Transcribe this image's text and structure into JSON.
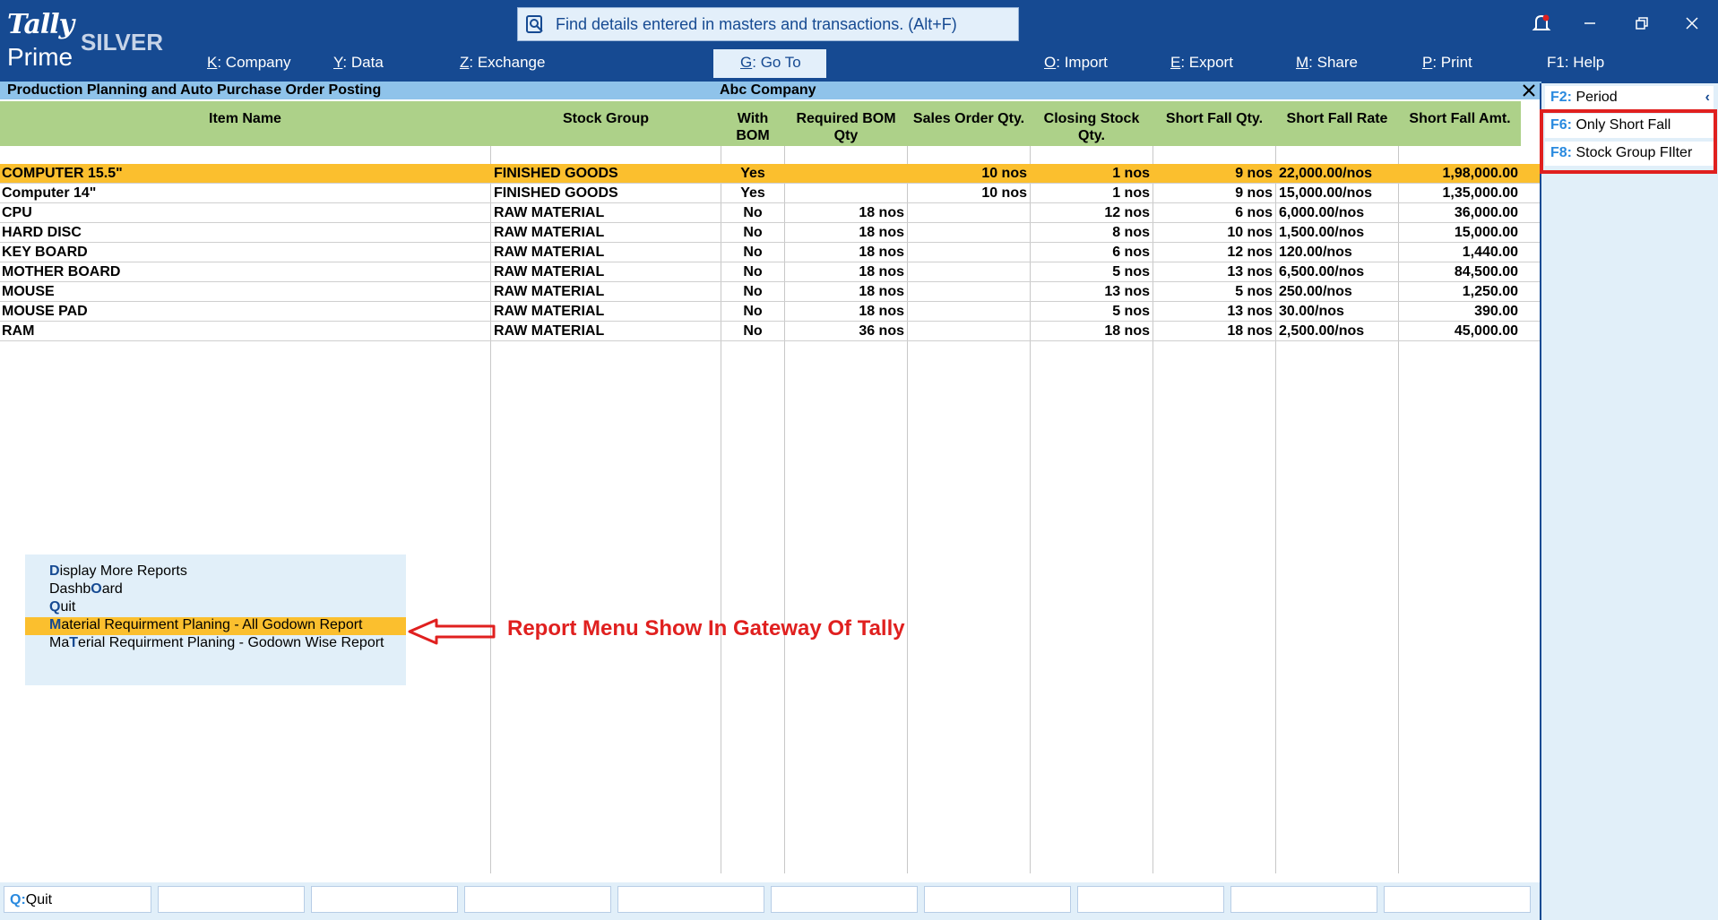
{
  "app": {
    "logo_top": "Tally",
    "logo_bottom": "Prime",
    "edition": "SILVER"
  },
  "search": {
    "text": "Find details entered in masters and transactions. (Alt+F)"
  },
  "menu": [
    {
      "key": "K",
      "label": "Company"
    },
    {
      "key": "Y",
      "label": "Data"
    },
    {
      "key": "Z",
      "label": "Exchange"
    },
    {
      "key": "G",
      "label": "Go To"
    },
    {
      "key": "O",
      "label": "Import"
    },
    {
      "key": "E",
      "label": "Export"
    },
    {
      "key": "M",
      "label": "Share"
    },
    {
      "key": "P",
      "label": "Print"
    },
    {
      "key": "F1",
      "label": "Help"
    }
  ],
  "report": {
    "title": "Production Planning and Auto Purchase Order Posting",
    "company": "Abc Company"
  },
  "right_panel": [
    {
      "key": "F2:",
      "label": "Period"
    },
    {
      "key": "F6:",
      "label": "Only Short Fall"
    },
    {
      "key": "F8:",
      "label": "Stock Group FIlter"
    }
  ],
  "table": {
    "headers": [
      "Item Name",
      "Stock Group",
      "With BOM",
      "Required BOM Qty",
      "Sales Order Qty.",
      "Closing Stock Qty.",
      "Short Fall Qty.",
      "Short Fall Rate",
      "Short Fall Amt."
    ],
    "rows": [
      [
        "COMPUTER 15.5\"",
        "FINISHED GOODS",
        "Yes",
        "",
        "10 nos",
        "1 nos",
        "9 nos",
        "22,000.00/nos",
        "1,98,000.00"
      ],
      [
        "Computer 14\"",
        "FINISHED GOODS",
        "Yes",
        "",
        "10 nos",
        "1 nos",
        "9 nos",
        "15,000.00/nos",
        "1,35,000.00"
      ],
      [
        "CPU",
        "RAW MATERIAL",
        "No",
        "18 nos",
        "",
        "12 nos",
        "6 nos",
        "6,000.00/nos",
        "36,000.00"
      ],
      [
        "HARD DISC",
        "RAW MATERIAL",
        "No",
        "18 nos",
        "",
        "8 nos",
        "10 nos",
        "1,500.00/nos",
        "15,000.00"
      ],
      [
        "KEY BOARD",
        "RAW MATERIAL",
        "No",
        "18 nos",
        "",
        "6 nos",
        "12 nos",
        "120.00/nos",
        "1,440.00"
      ],
      [
        "MOTHER BOARD",
        "RAW MATERIAL",
        "No",
        "18 nos",
        "",
        "5 nos",
        "13 nos",
        "6,500.00/nos",
        "84,500.00"
      ],
      [
        "MOUSE",
        "RAW MATERIAL",
        "No",
        "18 nos",
        "",
        "13 nos",
        "5 nos",
        "250.00/nos",
        "1,250.00"
      ],
      [
        "MOUSE PAD",
        "RAW MATERIAL",
        "No",
        "18 nos",
        "",
        "5 nos",
        "13 nos",
        "30.00/nos",
        "390.00"
      ],
      [
        "RAM",
        "RAW MATERIAL",
        "No",
        "36 nos",
        "",
        "18 nos",
        "18 nos",
        "2,500.00/nos",
        "45,000.00"
      ]
    ]
  },
  "popup": [
    {
      "key": "D",
      "rest": "isplay More Reports"
    },
    {
      "pre": "Dashb",
      "key": "O",
      "rest": "ard"
    },
    {
      "key": "Q",
      "rest": "uit"
    },
    {
      "key": "M",
      "rest": "aterial Requirment Planing - All Godown Report"
    },
    {
      "pre": "Ma",
      "key": "T",
      "rest": "erial Requirment Planing - Godown Wise Report"
    }
  ],
  "annotation": "Report Menu Show In Gateway Of Tally",
  "bottom_bar": {
    "key": "Q:",
    "label": "Quit"
  },
  "colors": {
    "brand": "#164a92",
    "header_green": "#add189",
    "selection": "#fbbf2e",
    "annotation_red": "#e0201f"
  }
}
